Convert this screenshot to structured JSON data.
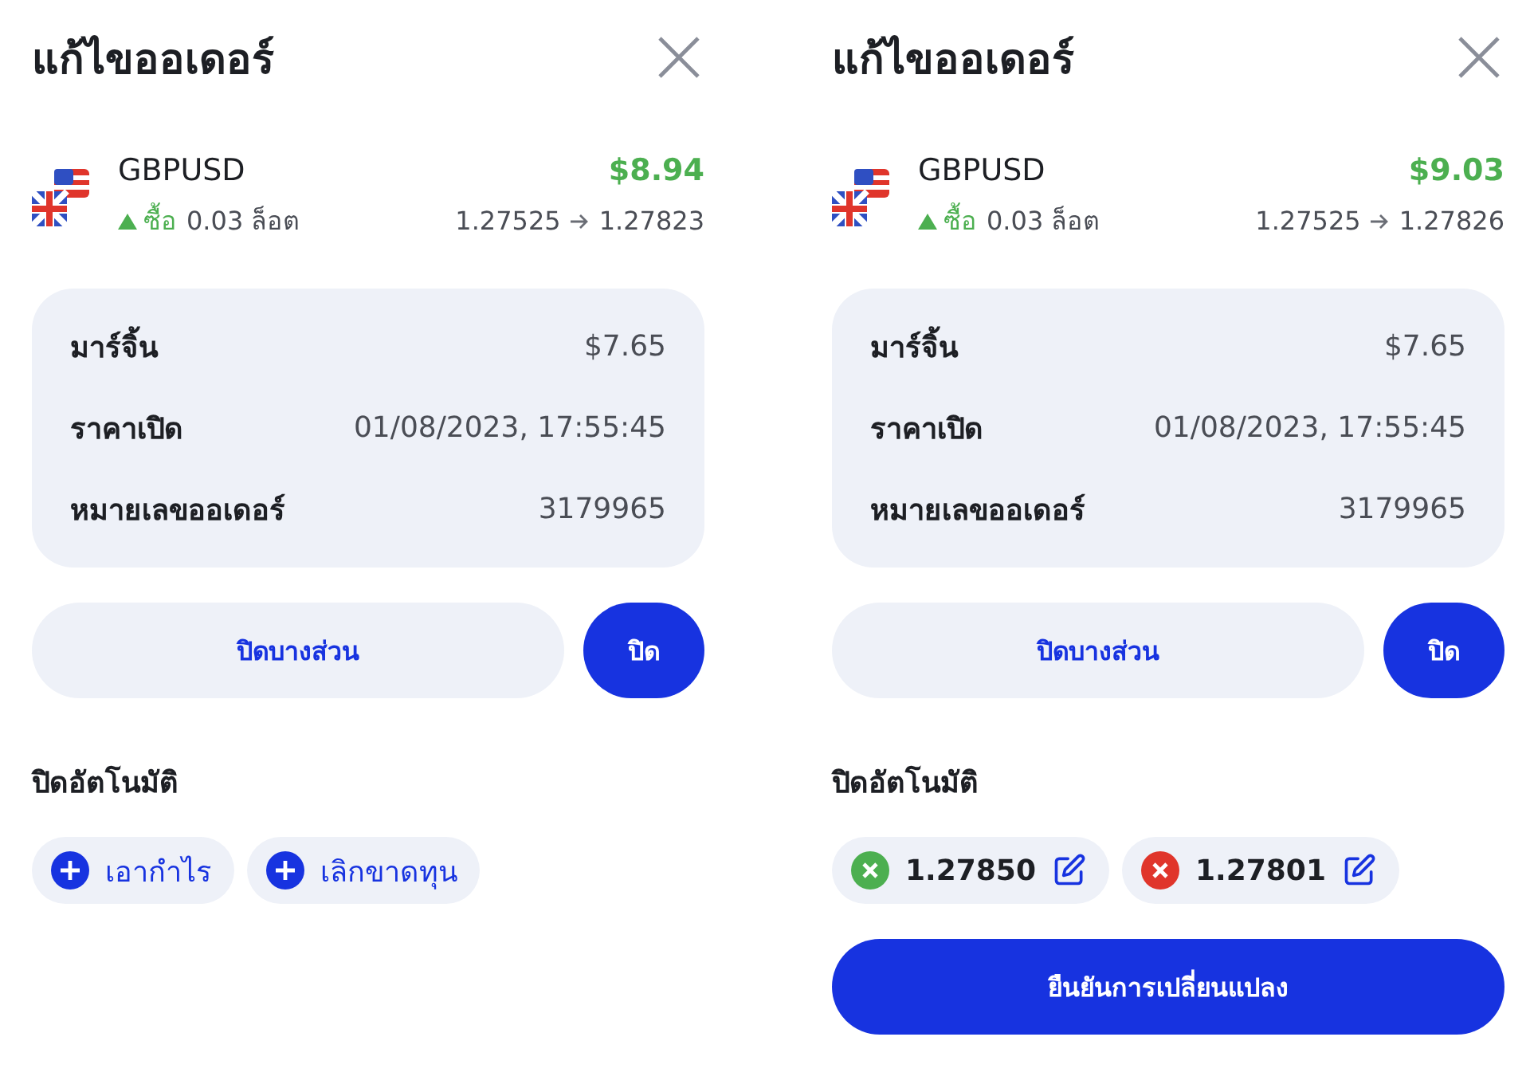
{
  "panels": [
    {
      "title": "แก้ไขออเดอร์",
      "symbol": "GBPUSD",
      "profit": "$8.94",
      "side": {
        "label": "ซื้อ",
        "kind": "buy"
      },
      "volume": "0.03 ล็อต",
      "open_price": "1.27525",
      "current_price": "1.27823",
      "details": [
        {
          "label": "มาร์จิ้น",
          "value": "$7.65"
        },
        {
          "label": "ราคาเปิด",
          "value": "01/08/2023, 17:55:45"
        },
        {
          "label": "หมายเลขออเดอร์",
          "value": "3179965"
        }
      ],
      "partial_close_button": "ปิดบางส่วน",
      "close_button": "ปิด",
      "auto_close_label": "ปิดอัตโนมัติ",
      "auto_close": [
        {
          "kind": "add",
          "label": "เอากำไร"
        },
        {
          "kind": "add",
          "label": "เลิกขาดทุน"
        }
      ]
    },
    {
      "title": "แก้ไขออเดอร์",
      "symbol": "GBPUSD",
      "profit": "$9.03",
      "side": {
        "label": "ซื้อ",
        "kind": "buy"
      },
      "volume": "0.03 ล็อต",
      "open_price": "1.27525",
      "current_price": "1.27826",
      "details": [
        {
          "label": "มาร์จิ้น",
          "value": "$7.65"
        },
        {
          "label": "ราคาเปิด",
          "value": "01/08/2023, 17:55:45"
        },
        {
          "label": "หมายเลขออเดอร์",
          "value": "3179965"
        }
      ],
      "partial_close_button": "ปิดบางส่วน",
      "close_button": "ปิด",
      "auto_close_label": "ปิดอัตโนมัติ",
      "auto_close": [
        {
          "kind": "level",
          "label": "1.27850",
          "color": "#4caf50"
        },
        {
          "kind": "level",
          "label": "1.27801",
          "color": "#e0352b"
        }
      ],
      "confirm_button": "ยืนยันการเปลี่ยนแปลง"
    }
  ]
}
